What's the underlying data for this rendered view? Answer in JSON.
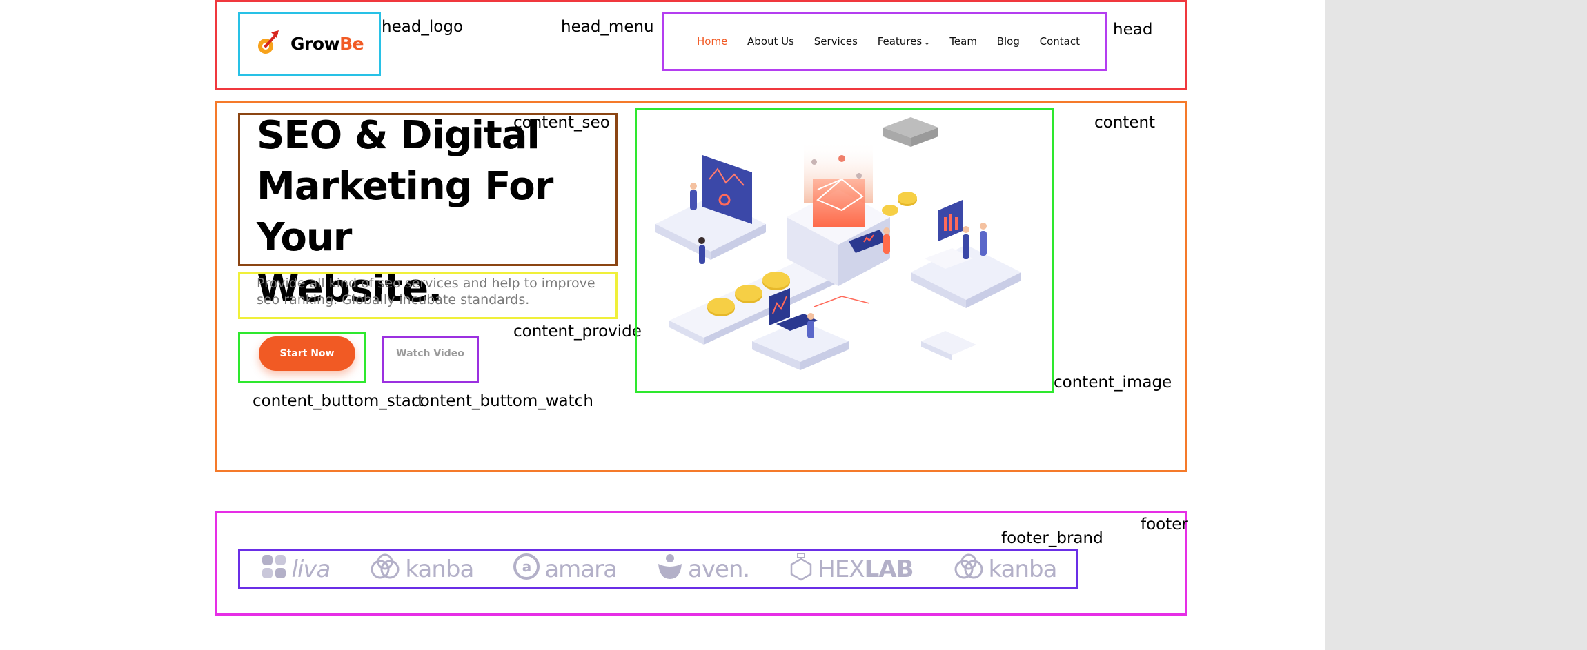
{
  "header": {
    "logo": {
      "part1": "Grow",
      "part2": "Be",
      "accent": "#f15a24",
      "icon": "rocket-arrow-icon"
    },
    "menu": [
      {
        "label": "Home",
        "active": true
      },
      {
        "label": "About Us"
      },
      {
        "label": "Services"
      },
      {
        "label": "Features",
        "has_dropdown": true
      },
      {
        "label": "Team"
      },
      {
        "label": "Blog"
      },
      {
        "label": "Contact"
      }
    ]
  },
  "hero": {
    "headline_lines": [
      "SEO & Digital",
      "Marketing For Your",
      "Website."
    ],
    "description_lines": [
      "Provide all kind of seo services and help to improve",
      "seo ranking. Globally incubate standards."
    ],
    "start_button": "Start Now",
    "watch_button": "Watch Video",
    "illustration": "isometric-seo-illustration"
  },
  "brands": [
    {
      "name": "liva",
      "icon": "liva-logo-icon"
    },
    {
      "name": "kanba",
      "icon": "kanba-logo-icon"
    },
    {
      "name": "amara",
      "icon": "amara-logo-icon"
    },
    {
      "name": "aven.",
      "icon": "aven-logo-icon"
    },
    {
      "name_part1": "HEX",
      "name_part2": "LAB",
      "icon": "hexlab-logo-icon"
    },
    {
      "name": "kanba",
      "icon": "kanba-logo-icon"
    }
  ],
  "annotations": {
    "head_logo": "head_logo",
    "head_menu": "head_menu",
    "head": "head",
    "content_seo": "content_seo",
    "content": "content",
    "content_provide": "content_provide",
    "content_image": "content_image",
    "content_buttom_start": "content_buttom_start",
    "content_buttom_watch": "content_buttom_watch",
    "footer": "footer",
    "footer_brand": "footer_brand"
  },
  "colors": {
    "accent": "#f15a24",
    "brand_gray": "#b3b0c8",
    "box_head": "#f0383e",
    "box_logo": "#28c1e6",
    "box_menu": "#b43ef0",
    "box_content": "#f57a2a",
    "box_seo": "#8b4513",
    "box_provide": "#f0f03a",
    "box_green": "#2ee82e",
    "box_watch": "#9b30e0",
    "box_footer": "#e62ee6",
    "box_brand": "#6a2ee6"
  }
}
